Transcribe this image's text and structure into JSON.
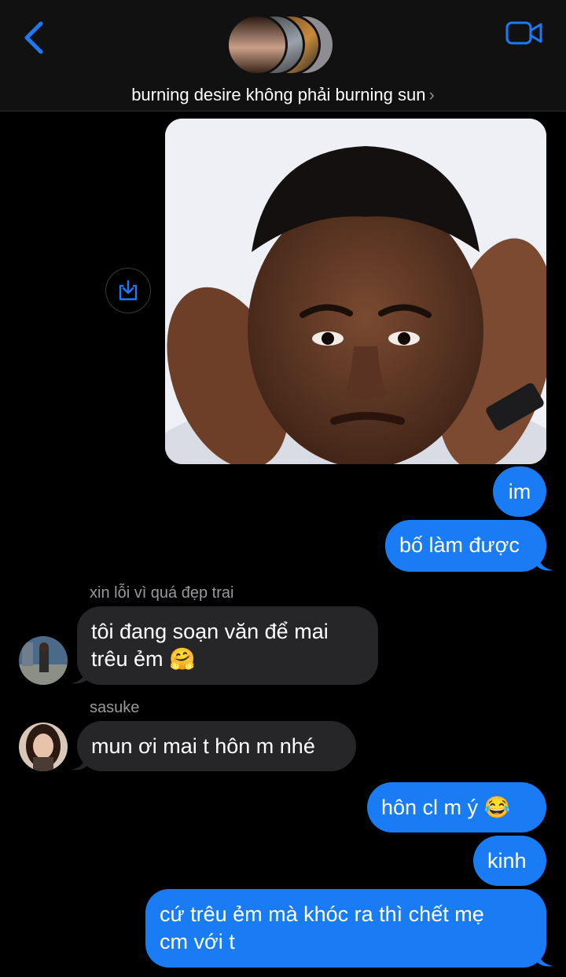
{
  "header": {
    "group_name": "burning desire không phải burning sun",
    "chevron": "›",
    "back_icon": "chevron-left-icon",
    "video_icon": "video-camera-icon",
    "accent": "#1a7cf5"
  },
  "messages": {
    "m1": "im",
    "m2": "bố làm được",
    "s1": "xin lỗi vì quá đẹp trai",
    "m3_line1": "tôi đang soạn văn để mai",
    "m3_line2": "trêu ẻm 🤗",
    "s2": "sasuke",
    "m4": "mun ơi mai t hôn m nhé",
    "m5": "hôn cl m ý 😂",
    "m6": "kinh",
    "m7_line1": "cứ trêu ẻm mà khóc ra thì chết mẹ",
    "m7_line2": "cm với t"
  },
  "colors": {
    "outgoing_bubble": "#1a7cf5",
    "incoming_bubble": "#262628"
  }
}
